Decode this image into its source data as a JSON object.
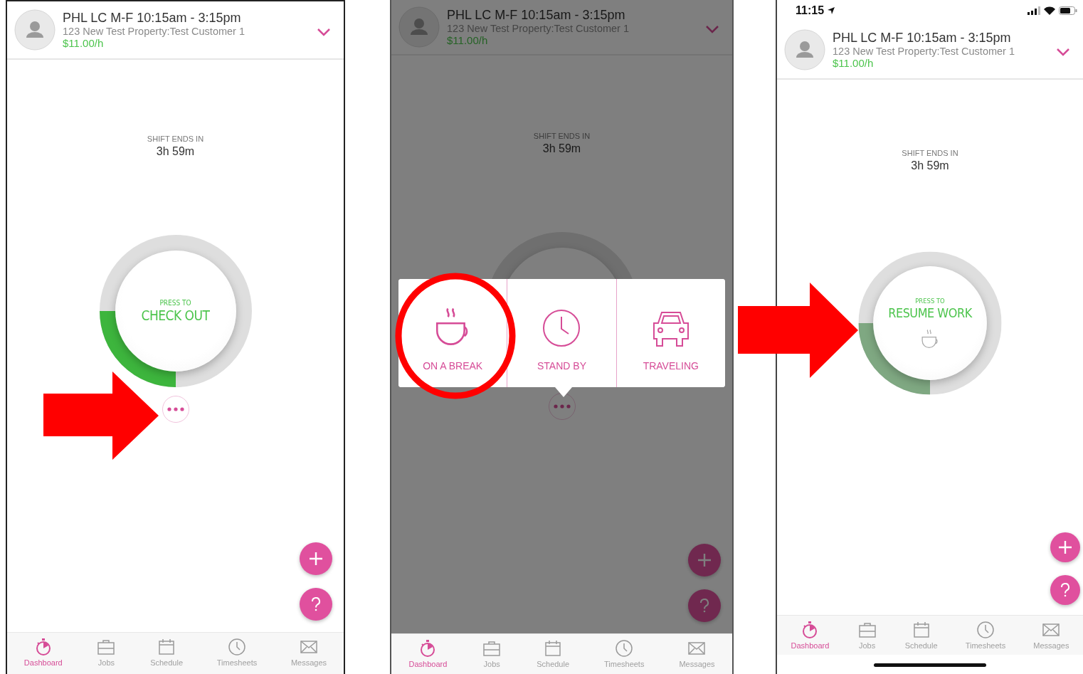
{
  "screens": [
    {
      "header": {
        "title": "PHL LC M-F 10:15am - 3:15pm",
        "address": "123 New Test Property:Test Customer 1",
        "rate": "$11.00/h"
      },
      "shift_label": "SHIFT ENDS IN",
      "shift_time": "3h 59m",
      "dimmed": false,
      "ring": {
        "prompt": "PRESS TO",
        "action": "CHECK OUT",
        "level": 0.25,
        "paused": false
      },
      "tabs": [
        {
          "label": "Dashboard",
          "selected": true
        },
        {
          "label": "Jobs",
          "selected": false
        },
        {
          "label": "Schedule",
          "selected": false
        },
        {
          "label": "Timesheets",
          "selected": false
        },
        {
          "label": "Messages",
          "selected": false
        }
      ]
    },
    {
      "header": {
        "title": "PHL LC M-F 10:15am - 3:15pm",
        "address": "123 New Test Property:Test Customer 1",
        "rate": "$11.00/h"
      },
      "shift_label": "SHIFT ENDS IN",
      "shift_time": "3h 59m",
      "dimmed": true,
      "menu": [
        {
          "kind": "break",
          "label": "ON A BREAK"
        },
        {
          "kind": "standby",
          "label": "STAND BY"
        },
        {
          "kind": "travel",
          "label": "TRAVELING"
        }
      ],
      "tabs": [
        {
          "label": "Dashboard",
          "selected": true
        },
        {
          "label": "Jobs",
          "selected": false
        },
        {
          "label": "Schedule",
          "selected": false
        },
        {
          "label": "Timesheets",
          "selected": false
        },
        {
          "label": "Messages",
          "selected": false
        }
      ]
    },
    {
      "status_bar": {
        "time": "11:15"
      },
      "header": {
        "title": "PHL LC M-F 10:15am - 3:15pm",
        "address": "123 New Test Property:Test Customer 1",
        "rate": "$11.00/h"
      },
      "shift_label": "SHIFT ENDS IN",
      "shift_time": "3h 59m",
      "dimmed": false,
      "ring": {
        "prompt": "PRESS TO",
        "action": "RESUME WORK",
        "level": 0.25,
        "paused": true
      },
      "tabs": [
        {
          "label": "Dashboard",
          "selected": true
        },
        {
          "label": "Jobs",
          "selected": false
        },
        {
          "label": "Schedule",
          "selected": false
        },
        {
          "label": "Timesheets",
          "selected": false
        },
        {
          "label": "Messages",
          "selected": false
        }
      ],
      "home_indicator": true
    }
  ]
}
